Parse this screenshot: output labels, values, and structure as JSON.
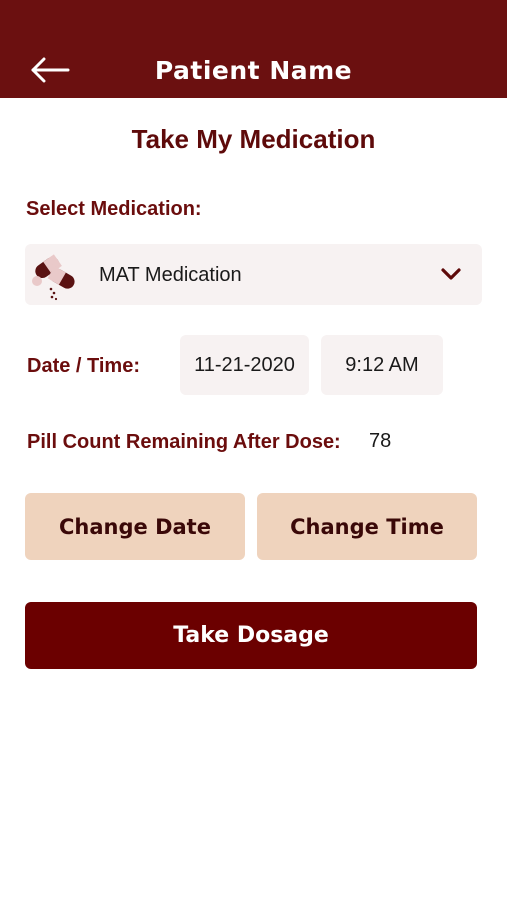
{
  "header": {
    "title": "Patient Name",
    "back_icon": "arrow-left-icon"
  },
  "page": {
    "title": "Take My Medication"
  },
  "medication": {
    "label": "Select Medication:",
    "selected": "MAT Medication",
    "icon": "pill-capsule-icon",
    "dropdown_icon": "chevron-down-icon"
  },
  "datetime": {
    "label": "Date / Time:",
    "date": "11-21-2020",
    "time": "9:12 AM"
  },
  "pill_count": {
    "label": "Pill Count Remaining After Dose:",
    "value": "78"
  },
  "buttons": {
    "change_date": "Change Date",
    "change_time": "Change Time",
    "take_dosage": "Take Dosage"
  },
  "colors": {
    "header_bg": "#6b1010",
    "primary": "#6b0000",
    "accent_soft": "#efd3bd",
    "field_bg": "#f7f2f2",
    "label_text": "#6b0d0d"
  }
}
